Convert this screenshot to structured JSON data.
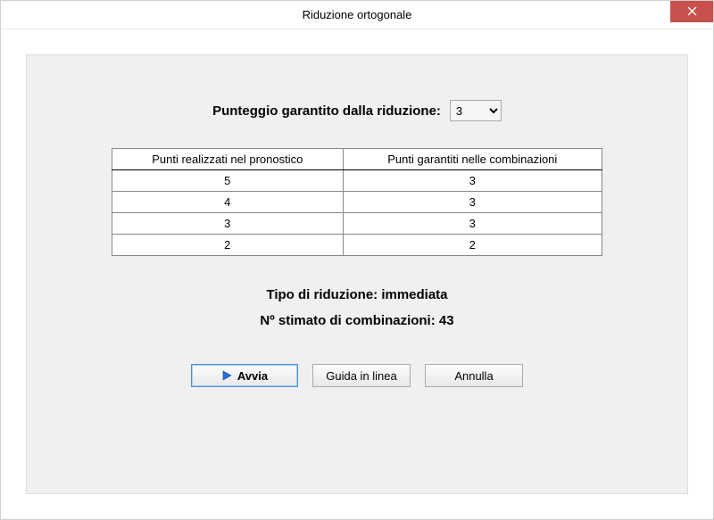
{
  "window": {
    "title": "Riduzione ortogonale"
  },
  "score": {
    "label": "Punteggio garantito dalla riduzione:",
    "value": "3"
  },
  "table": {
    "headers": {
      "col1": "Punti realizzati nel pronostico",
      "col2": "Punti garantiti nelle combinazioni"
    },
    "rows": [
      {
        "c1": "5",
        "c2": "3"
      },
      {
        "c1": "4",
        "c2": "3"
      },
      {
        "c1": "3",
        "c2": "3"
      },
      {
        "c1": "2",
        "c2": "2"
      }
    ]
  },
  "info": {
    "line1": "Tipo di riduzione: immediata",
    "line2": "Nº stimato di combinazioni: 43"
  },
  "buttons": {
    "start": "Avvia",
    "help": "Guida in linea",
    "cancel": "Annulla"
  }
}
